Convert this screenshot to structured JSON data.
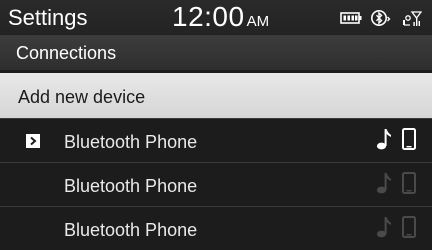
{
  "status_bar": {
    "title": "Settings",
    "time": "12:00",
    "ampm": "AM",
    "icons": [
      "battery-icon",
      "bluetooth-audio-icon",
      "signal-icon"
    ]
  },
  "section": {
    "title": "Connections"
  },
  "add_device": {
    "label": "Add new device"
  },
  "devices": [
    {
      "label": "Bluetooth Phone",
      "connected": true,
      "icons": [
        "music-note-icon",
        "phone-icon"
      ]
    },
    {
      "label": "Bluetooth Phone",
      "connected": false,
      "icons": [
        "music-note-icon",
        "phone-icon"
      ]
    },
    {
      "label": "Bluetooth Phone",
      "connected": false,
      "icons": [
        "music-note-icon",
        "phone-icon"
      ]
    }
  ],
  "colors": {
    "background": "#1c1c1c",
    "highlight": "#dcdcdc",
    "active_icon": "#ffffff",
    "inactive_icon": "#4a4a4a"
  }
}
